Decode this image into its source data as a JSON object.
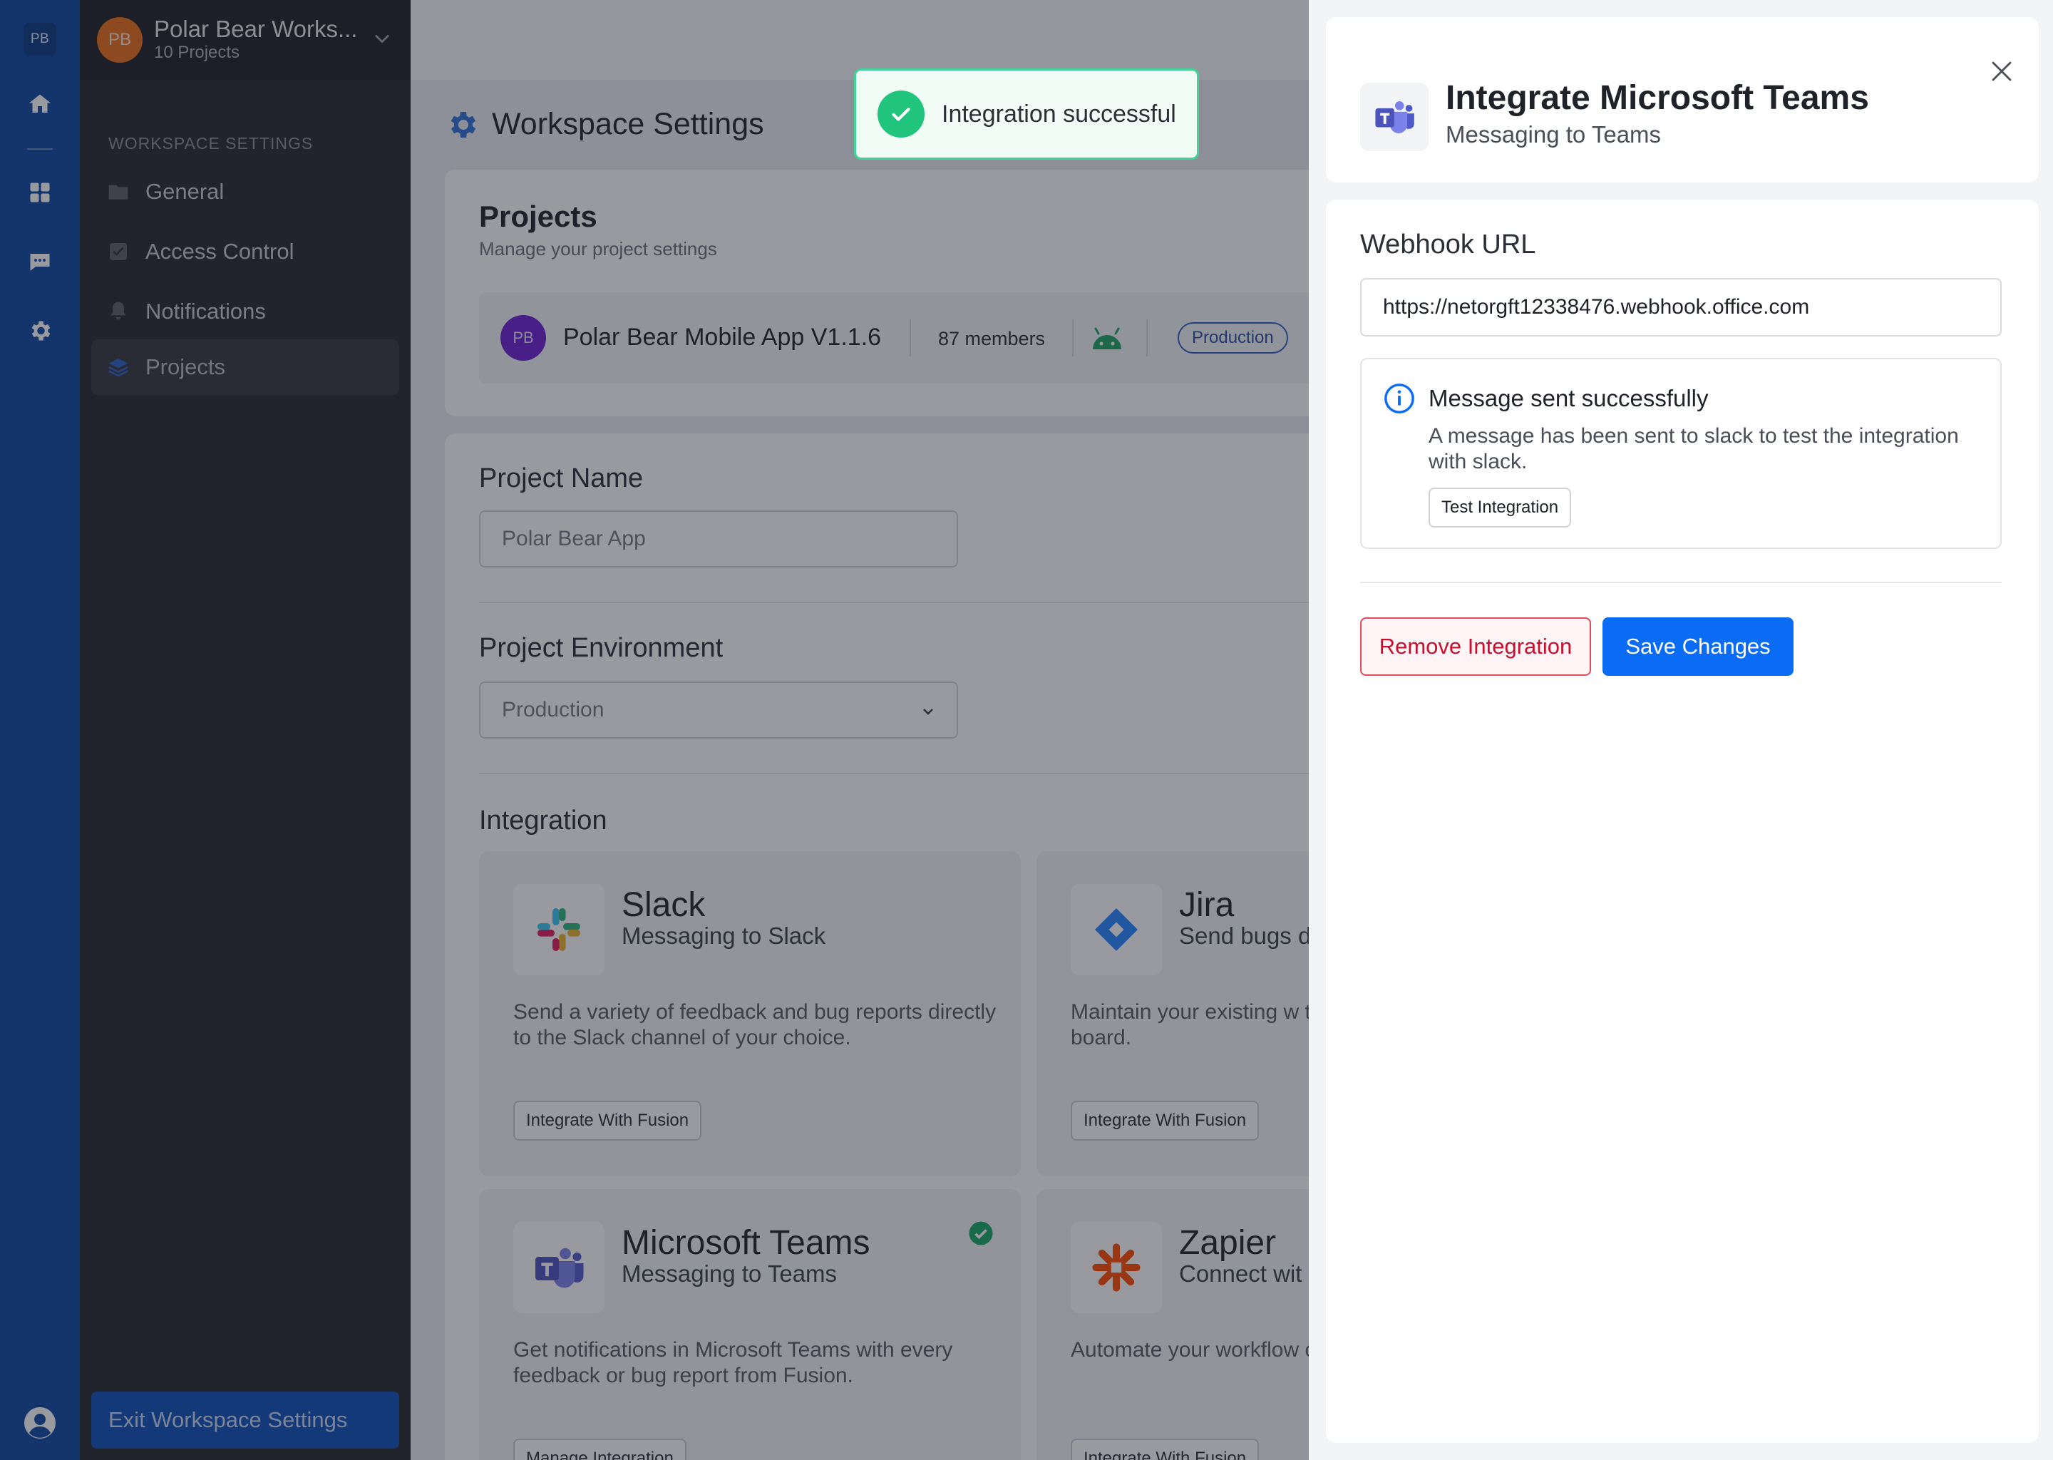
{
  "rail": {
    "logo_text": "PB",
    "icons": [
      "home-icon",
      "grid-icon",
      "chat-icon",
      "gear-icon",
      "user-icon"
    ],
    "accent": "#0d47a1"
  },
  "sidebar": {
    "workspace_avatar": "PB",
    "workspace_name": "Polar Bear Works...",
    "workspace_sub": "10 Projects",
    "section_label": "WORKSPACE SETTINGS",
    "items": [
      {
        "label": "General",
        "icon": "folder-icon"
      },
      {
        "label": "Access Control",
        "icon": "check-square-icon"
      },
      {
        "label": "Notifications",
        "icon": "bell-icon"
      },
      {
        "label": "Projects",
        "icon": "layers-icon",
        "active": true
      }
    ],
    "exit_label": "Exit Workspace Settings"
  },
  "main": {
    "page_title": "Workspace Settings",
    "projects": {
      "title": "Projects",
      "subtitle": "Manage your project settings",
      "row": {
        "avatar": "PB",
        "name": "Polar Bear Mobile App V1.1.6",
        "members": "87 members",
        "platform_icon": "android-icon",
        "environment": "Production"
      }
    },
    "project_name": {
      "label": "Project Name",
      "value": "Polar Bear App"
    },
    "project_environment": {
      "label": "Project Environment",
      "value": "Production"
    },
    "integration": {
      "title": "Integration",
      "cards": [
        {
          "name": "Slack",
          "tagline": "Messaging to Slack",
          "description": "Send a variety of feedback and bug reports directly to the Slack channel of your choice.",
          "button": "Integrate With Fusion"
        },
        {
          "name": "Jira",
          "tagline": "Send bugs d",
          "description": "Maintain your existing w that automatically arrive board.",
          "button": "Integrate With Fusion"
        },
        {
          "name": "Microsoft Teams",
          "tagline": "Messaging to Teams",
          "description": "Get notifications in Microsoft Teams with every feedback or bug report from Fusion.",
          "button": "Manage Integration",
          "connected": true
        },
        {
          "name": "Zapier",
          "tagline": "Connect wit",
          "description": "Automate your workflow connect the apps you u",
          "button": "Integrate With Fusion"
        }
      ]
    }
  },
  "toast": {
    "text": "Integration successful",
    "color": "#21c47c"
  },
  "panel": {
    "title": "Integrate Microsoft Teams",
    "subtitle": "Messaging to Teams",
    "webhook_label": "Webhook URL",
    "webhook_value": "https://netorgft12338476.webhook.office.com",
    "info_title": "Message sent successfully",
    "info_text": "A message has been sent to slack to test the integration with slack.",
    "test_button": "Test Integration",
    "remove_button": "Remove Integration",
    "save_button": "Save Changes",
    "save_color": "#0a6cf5",
    "remove_color": "#c8102e"
  }
}
